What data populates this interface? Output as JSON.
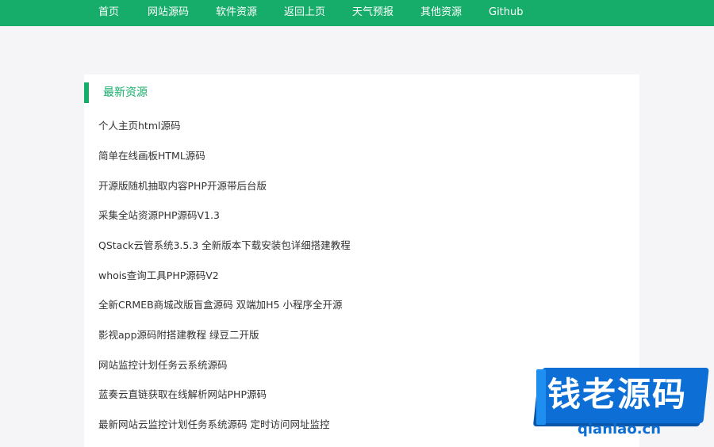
{
  "nav": {
    "items": [
      {
        "label": "首页"
      },
      {
        "label": "网站源码"
      },
      {
        "label": "软件资源"
      },
      {
        "label": "返回上页"
      },
      {
        "label": "天气预报"
      },
      {
        "label": "其他资源"
      },
      {
        "label": "Github"
      }
    ]
  },
  "section": {
    "title": "最新资源",
    "items": [
      {
        "label": "个人主页html源码"
      },
      {
        "label": "简单在线画板HTML源码"
      },
      {
        "label": "开源版随机抽取内容PHP开源带后台版"
      },
      {
        "label": "采集全站资源PHP源码V1.3"
      },
      {
        "label": "QStack云管系统3.5.3 全新版本下载安装包详细搭建教程"
      },
      {
        "label": "whois查询工具PHP源码V2"
      },
      {
        "label": "全新CRMEB商城改版盲盒源码 双端加H5 小程序全开源"
      },
      {
        "label": "影视app源码附搭建教程 绿豆二开版"
      },
      {
        "label": "网站监控计划任务云系统源码"
      },
      {
        "label": "蓝奏云直链获取在线解析网站PHP源码"
      },
      {
        "label": "最新网站云监控计划任务系统源码 定时访问网址监控"
      }
    ]
  },
  "watermark": {
    "text": "钱老源码",
    "sub": "qianlao.cn"
  },
  "colors": {
    "brand": "#16ad6a",
    "watermark": "#0d6fd6"
  }
}
